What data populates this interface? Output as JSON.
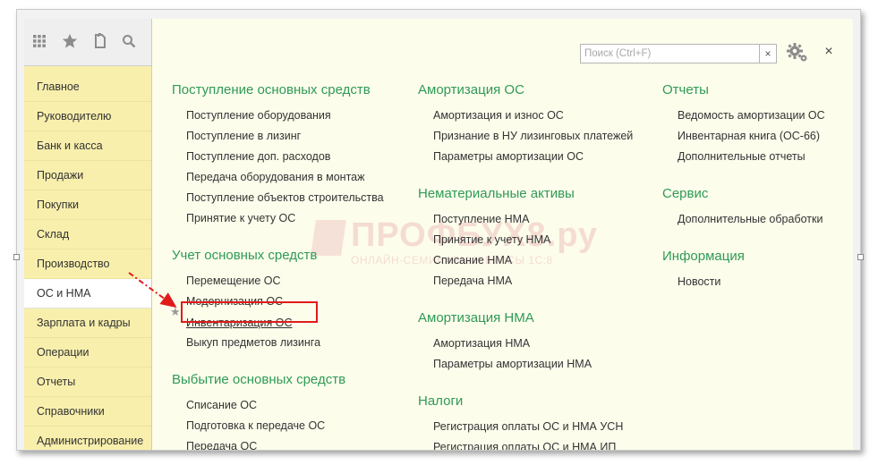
{
  "search": {
    "placeholder": "Поиск (Ctrl+F)",
    "clear": "×"
  },
  "window": {
    "close": "×"
  },
  "icons": {
    "apps": "apps-grid-icon",
    "favorites": "star-icon",
    "history": "history-icon",
    "search": "search-icon",
    "settings": "gear-icon",
    "close": "close-icon"
  },
  "colors": {
    "accent": "#2e9a55",
    "sidebar": "#f8efad",
    "main_bg": "#fdfdec",
    "highlight": "#e01b1b"
  },
  "sidebar": {
    "items": [
      {
        "label": "Главное"
      },
      {
        "label": "Руководителю"
      },
      {
        "label": "Банк и касса"
      },
      {
        "label": "Продажи"
      },
      {
        "label": "Покупки"
      },
      {
        "label": "Склад"
      },
      {
        "label": "Производство"
      },
      {
        "label": "ОС и НМА",
        "active": true
      },
      {
        "label": "Зарплата и кадры"
      },
      {
        "label": "Операции"
      },
      {
        "label": "Отчеты"
      },
      {
        "label": "Справочники"
      },
      {
        "label": "Администрирование"
      }
    ]
  },
  "col1": {
    "sec1": {
      "title": "Поступление основных средств",
      "links": [
        "Поступление оборудования",
        "Поступление в лизинг",
        "Поступление доп. расходов",
        "Передача оборудования в монтаж",
        "Поступление объектов строительства",
        "Принятие к учету ОС"
      ]
    },
    "sec2": {
      "title": "Учет основных средств",
      "links": [
        "Перемещение ОС",
        "Модернизация ОС",
        "Инвентаризация ОС",
        "Выкуп предметов лизинга"
      ]
    },
    "sec3": {
      "title": "Выбытие основных средств",
      "links": [
        "Списание ОС",
        "Подготовка к передаче ОС",
        "Передача ОС"
      ]
    }
  },
  "col2": {
    "sec1": {
      "title": "Амортизация ОС",
      "links": [
        "Амортизация и износ ОС",
        "Признание в НУ лизинговых платежей",
        "Параметры амортизации ОС"
      ]
    },
    "sec2": {
      "title": "Нематериальные активы",
      "links": [
        "Поступление НМА",
        "Принятие к учету НМА",
        "Списание НМА",
        "Передача НМА"
      ]
    },
    "sec3": {
      "title": "Амортизация НМА",
      "links": [
        "Амортизация НМА",
        "Параметры амортизации НМА"
      ]
    },
    "sec4": {
      "title": "Налоги",
      "links": [
        "Регистрация оплаты ОС и НМА УСН",
        "Регистрация оплаты ОС и НМА ИП"
      ]
    }
  },
  "col3": {
    "sec1": {
      "title": "Отчеты",
      "links": [
        "Ведомость амортизации ОС",
        "Инвентарная книга (ОС-66)",
        "Дополнительные отчеты"
      ]
    },
    "sec2": {
      "title": "Сервис",
      "links": [
        "Дополнительные обработки"
      ]
    },
    "sec3": {
      "title": "Информация",
      "links": [
        "Новости"
      ]
    }
  },
  "watermark": {
    "title": "ПРОФБУХ8.ру",
    "subtitle": "ОНЛАЙН-СЕМИНАРЫ И КУРСЫ 1С:8"
  }
}
